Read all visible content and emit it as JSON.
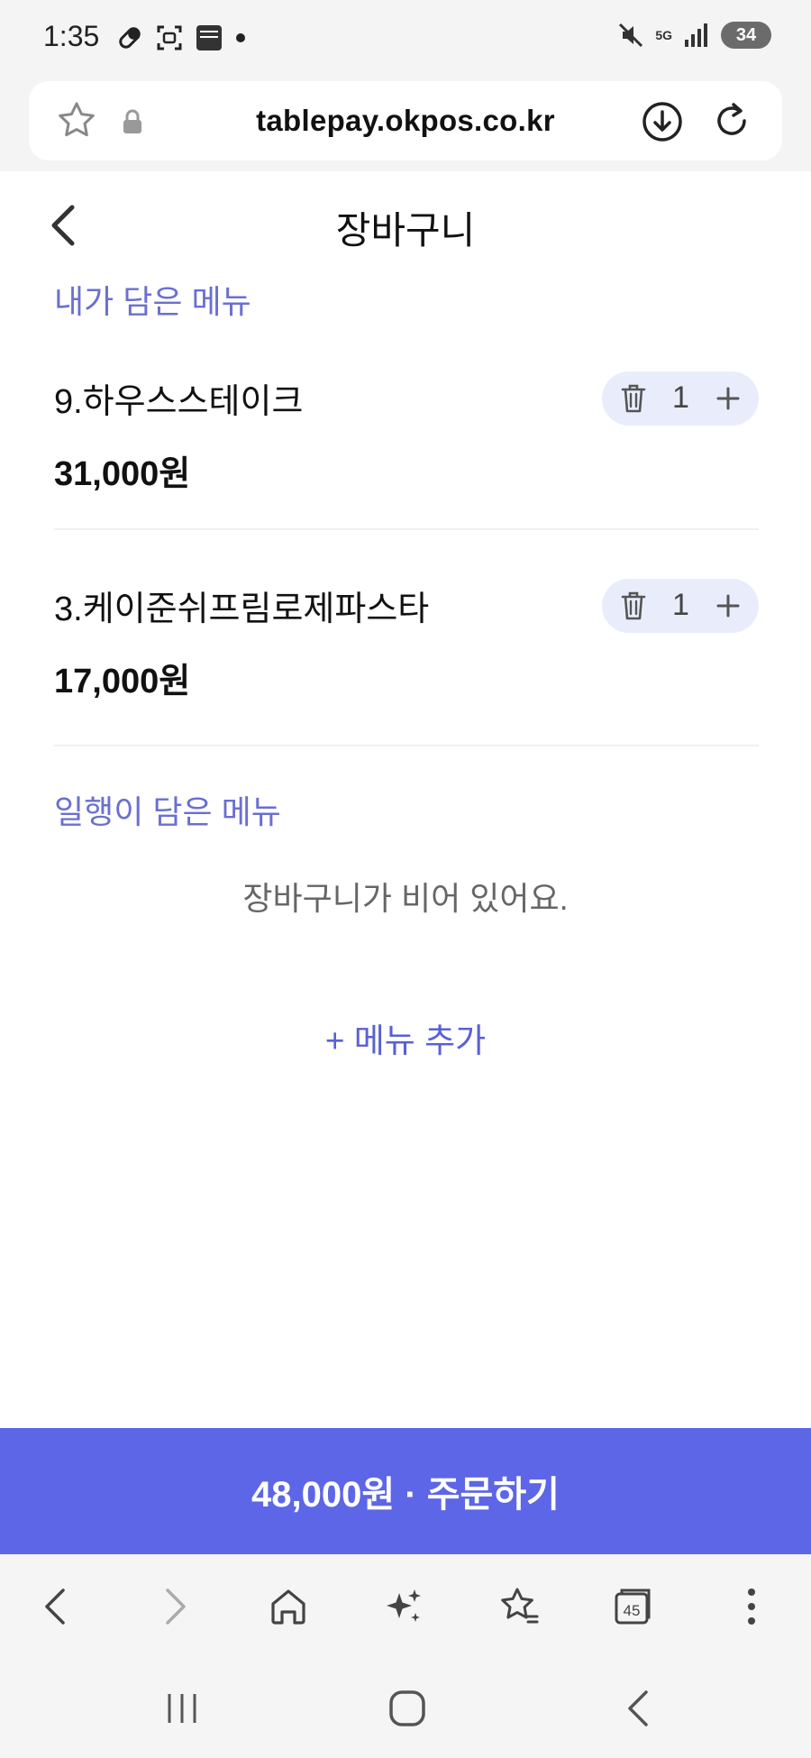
{
  "status_bar": {
    "time": "1:35",
    "network": "5G",
    "battery": "34"
  },
  "browser": {
    "url": "tablepay.okpos.co.kr",
    "tab_count": "45"
  },
  "page": {
    "title": "장바구니"
  },
  "my_menu": {
    "section_label": "내가 담은 메뉴",
    "items": [
      {
        "name": "9.하우스스테이크",
        "price": "31,000원",
        "quantity": "1"
      },
      {
        "name": "3.케이준쉬프림로제파스타",
        "price": "17,000원",
        "quantity": "1"
      }
    ]
  },
  "party_menu": {
    "section_label": "일행이 담은 메뉴",
    "empty_message": "장바구니가 비어 있어요."
  },
  "add_menu_label": "+ 메뉴 추가",
  "order_button": {
    "label": "48,000원 · 주문하기"
  },
  "colors": {
    "accent": "#5c66e6",
    "section_label": "#6a6fd1",
    "stepper_bg": "#e9edfb"
  }
}
